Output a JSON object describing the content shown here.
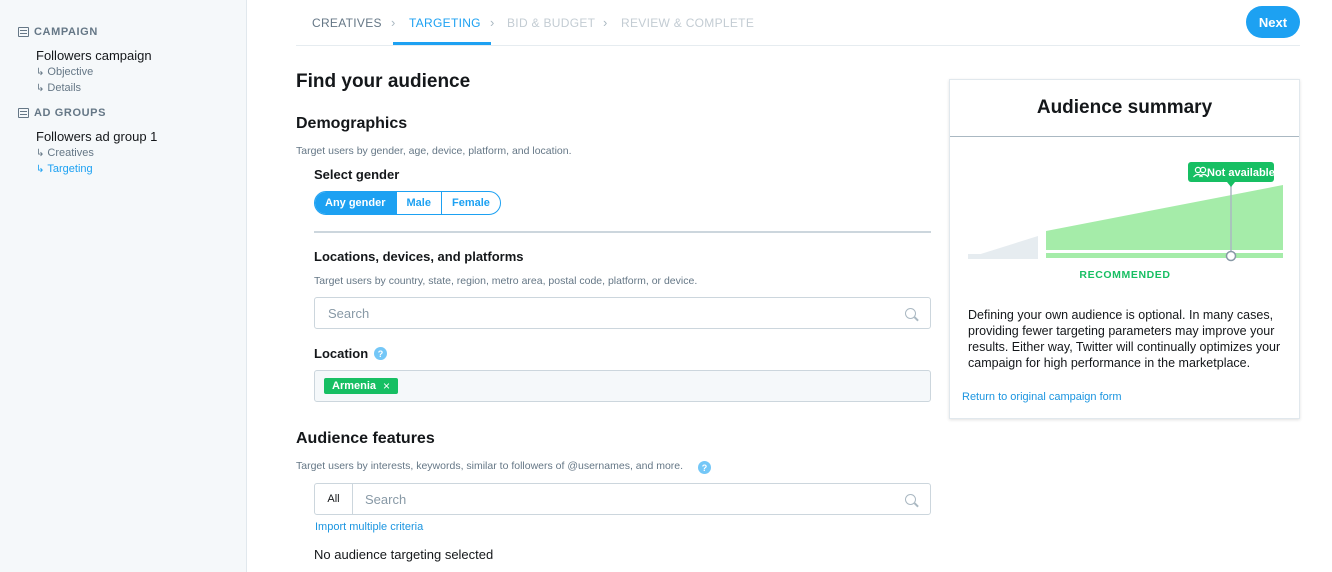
{
  "sidebar": {
    "campaign_section": "CAMPAIGN",
    "campaign_name": "Followers campaign",
    "campaign_items": [
      "Objective",
      "Details"
    ],
    "adgroups_section": "AD GROUPS",
    "adgroup_name": "Followers ad group 1",
    "adgroup_items": [
      "Creatives",
      "Targeting"
    ],
    "sub_arrow": "↳"
  },
  "steps": {
    "items": [
      "CREATIVES",
      "TARGETING",
      "BID & BUDGET",
      "REVIEW & COMPLETE"
    ],
    "active": "TARGETING",
    "chevron": "›"
  },
  "next_button": "Next",
  "main": {
    "title": "Find your audience",
    "demographics": {
      "heading": "Demographics",
      "description": "Target users by gender, age, device, platform, and location.",
      "gender_label": "Select gender",
      "gender_options": [
        "Any gender",
        "Male",
        "Female"
      ],
      "gender_selected": "Any gender"
    },
    "locations": {
      "heading": "Locations, devices, and platforms",
      "description": "Target users by country, state, region, metro area, postal code, platform, or device.",
      "search_placeholder": "Search",
      "location_label": "Location",
      "help": "?",
      "chips": [
        "Armenia"
      ],
      "chip_remove": "×"
    },
    "audience_features": {
      "heading": "Audience features",
      "description": "Target users by interests, keywords, similar to followers of @usernames, and more.",
      "help": "?",
      "filter_label": "All",
      "search_placeholder": "Search",
      "import_link": "Import multiple criteria",
      "empty_text": "No audience targeting selected"
    }
  },
  "summary": {
    "title": "Audience summary",
    "badge": "Not available",
    "recommended_label": "RECOMMENDED",
    "text": "Defining your own audience is optional. In many cases, providing fewer targeting parameters may improve your results. Either way, Twitter will continually optimizes your campaign for high performance in the marketplace.",
    "return_link": "Return to original campaign form",
    "colors": {
      "recommended": "#17bf63",
      "bar_fill": "#a5eca9",
      "inactive": "#e6ecf0"
    }
  },
  "colors": {
    "accent": "#1da1f2",
    "success": "#17bf63",
    "muted": "#657786"
  }
}
